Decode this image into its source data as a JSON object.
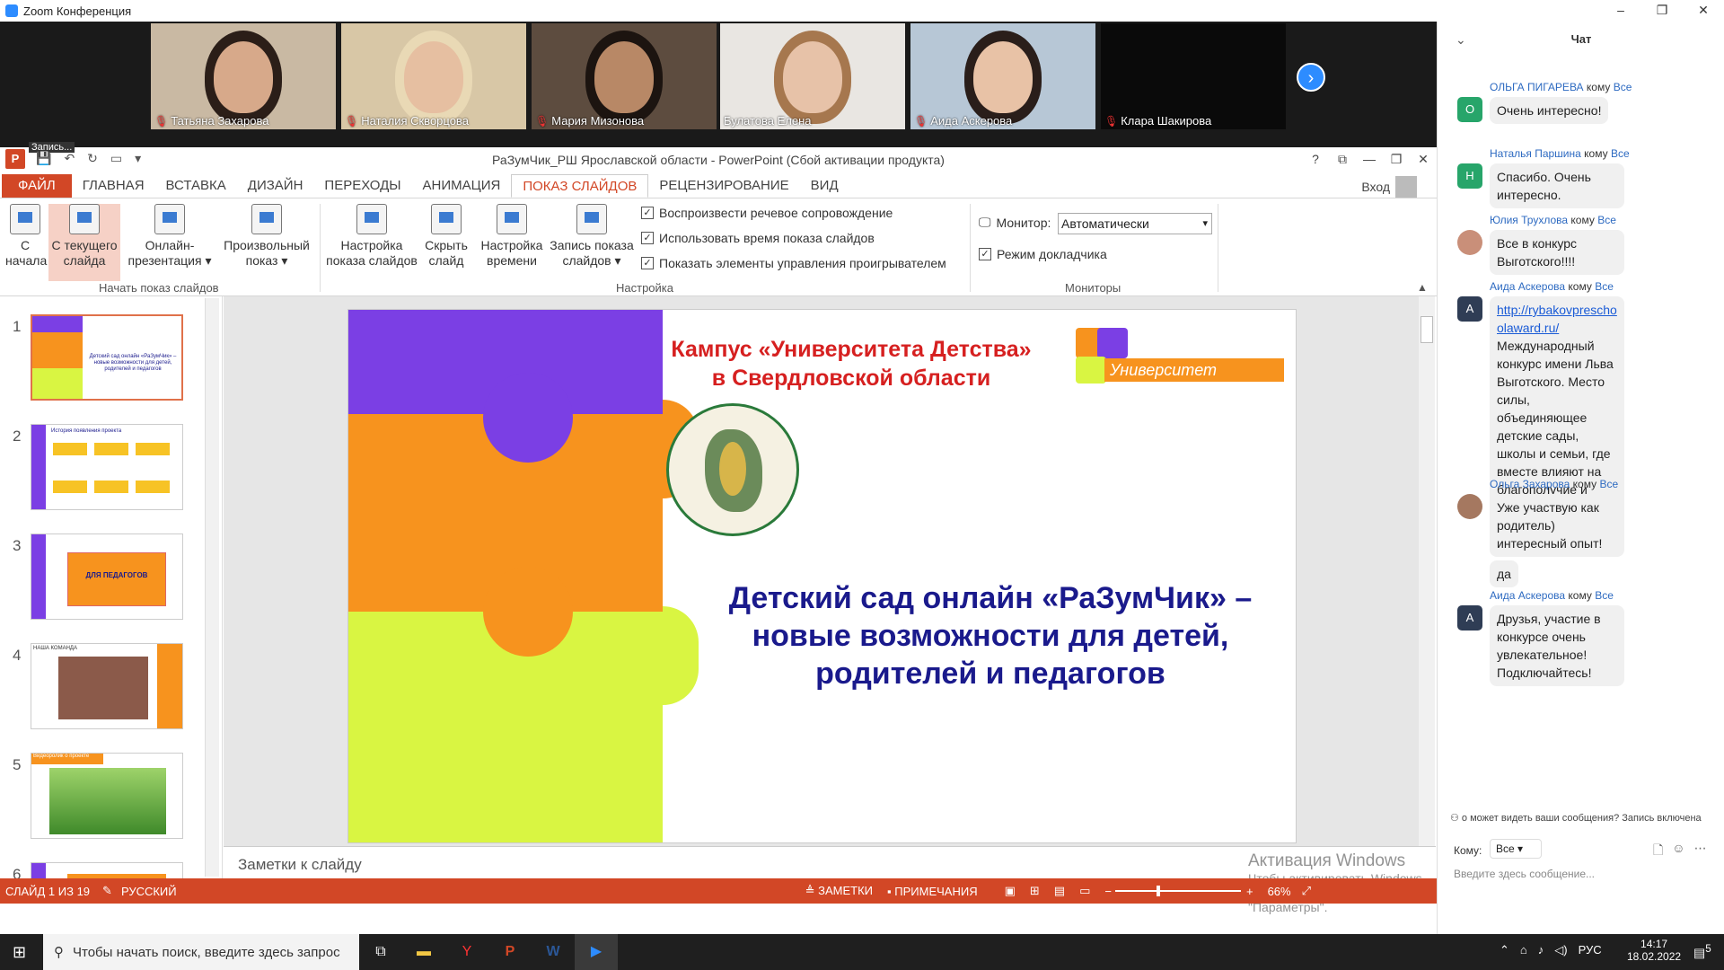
{
  "zoom": {
    "title": "Zoom Конференция",
    "win_min": "–",
    "win_max": "❐",
    "win_close": "✕"
  },
  "participants": [
    {
      "name": "Татьяна Захарова",
      "muted": true,
      "bg": "#c9b9a3",
      "face": "#d7a98a",
      "hair": "#2b1e18"
    },
    {
      "name": "Наталия Скворцова",
      "muted": true,
      "bg": "#d8c7a6",
      "face": "#e6bfa1",
      "hair": "#e9d9b5"
    },
    {
      "name": "Мария Мизонова",
      "muted": true,
      "bg": "#5d4c3f",
      "face": "#b88866",
      "hair": "#1c1410"
    },
    {
      "name": "Булатова Елена",
      "muted": false,
      "bg": "#e9e6e2",
      "face": "#e7c2a8",
      "hair": "#a6774e"
    },
    {
      "name": "Аида Аскерова",
      "muted": true,
      "bg": "#b7c7d6",
      "face": "#e8c2a6",
      "hair": "#2a1e1a"
    },
    {
      "name": "Клара Шакирова",
      "muted": true,
      "bg": "#0a0a0a",
      "face": "",
      "hair": ""
    }
  ],
  "ppt": {
    "title": "РаЗумЧик_РШ Ярославской области - PowerPoint (Сбой активации продукта)",
    "record_label": "Запись...",
    "help": "?",
    "restore": "⧉",
    "minimize": "—",
    "maximize": "❐",
    "close": "✕",
    "tabs": [
      "ФАЙЛ",
      "ГЛАВНАЯ",
      "ВСТАВКА",
      "ДИЗАЙН",
      "ПЕРЕХОДЫ",
      "АНИМАЦИЯ",
      "ПОКАЗ СЛАЙДОВ",
      "РЕЦЕНЗИРОВАНИЕ",
      "ВИД"
    ],
    "active_tab": "ПОКАЗ СЛАЙДОВ",
    "signin": "Вход",
    "ribbon": {
      "from_start": "С начала",
      "from_current": "С текущего слайда",
      "online": "Онлайн-презентация ▾",
      "custom": "Произвольный показ ▾",
      "group1": "Начать показ слайдов",
      "setup": "Настройка показа слайдов",
      "hide": "Скрыть слайд",
      "rehearse": "Настройка времени",
      "record": "Запись показа слайдов ▾",
      "chk1": "Воспроизвести речевое сопровождение",
      "chk2": "Использовать время показа слайдов",
      "chk3": "Показать элементы управления проигрывателем",
      "group2": "Настройка",
      "monitor_label": "Монитор:",
      "monitor_value": "Автоматически",
      "presenter": "Режим докладчика",
      "group3": "Мониторы"
    },
    "thumb_numbers": [
      "1",
      "2",
      "3",
      "4",
      "5",
      "6"
    ],
    "thumb_texts": {
      "t1": "Детский сад онлайн «РаЗумЧик» – новые возможности для детей, родителей и педагогов",
      "t2": "История появления проекта",
      "t3": "ДЛЯ ПЕДАГОГОВ",
      "t4": "НАША КОМАНДА",
      "t5": "Видеоролик о проекте"
    },
    "slide": {
      "campus_line1": "Кампус «Университета Детства»",
      "campus_line2": "в Свердловской области",
      "brand": "Университет Детства",
      "main_title": "Детский сад онлайн «РаЗумЧик» – новые возможности для детей, родителей и педагогов",
      "colors": {
        "purple": "#7b3fe4",
        "orange": "#f7931e",
        "lime": "#d9f542",
        "red": "#d62020",
        "navy": "#1a1a8c"
      }
    },
    "notes": "Заметки к слайду",
    "status": {
      "slide": "СЛАЙД 1 ИЗ 19",
      "lang": "РУССКИЙ",
      "notes_btn": "ЗАМЕТКИ",
      "comments_btn": "ПРИМЕЧАНИЯ",
      "zoom": "66%"
    },
    "activation": {
      "line1": "Активация Windows",
      "line2": "Чтобы активировать Windows, перейдите в раздел \"Параметры\"."
    }
  },
  "chat": {
    "title": "Чат",
    "messages": [
      {
        "from": "ОЛЬГА ПИГАРЕВА",
        "to": "Все",
        "initial": "О",
        "av": "#27a56a",
        "text": "Очень интересно!"
      },
      {
        "from": "Наталья Паршина",
        "to": "Все",
        "initial": "Н",
        "av": "#27a56a",
        "text": "Спасибо. Очень интересно."
      },
      {
        "from": "Юлия Трухлова",
        "to": "Все",
        "initial": "",
        "av": "#c98f79",
        "text": "Все в конкурс Выготского!!!!"
      },
      {
        "from": "Аида Аскерова",
        "to": "Все",
        "initial": "А",
        "av": "#2f3d55",
        "link": "http://rybakovpreschoolaward.ru/",
        "text": "Международный конкурс имени Льва Выготского. Место силы, объединяющее детские сады, школы и семьи, где вместе влияют на благополучие и качество жизни"
      },
      {
        "from": "Ольга Захарова",
        "to": "Все",
        "initial": "",
        "av": "#a57860",
        "text": "Уже участвую как родитель) интересный опыт!",
        "text2": "да"
      },
      {
        "from": "Аида Аскерова",
        "to": "Все",
        "initial": "А",
        "av": "#2f3d55",
        "text": "Друзья, участие в конкурсе очень увлекательное! Подключайтесь!"
      }
    ],
    "to_word": "кому",
    "notice": "о может видеть ваши сообщения? Запись включена",
    "to_label": "Кому:",
    "to_value": "Все",
    "placeholder": "Введите здесь сообщение..."
  },
  "taskbar": {
    "search": "Чтобы начать поиск, введите здесь запрос",
    "lang": "РУС",
    "time": "14:17",
    "date": "18.02.2022",
    "notif": "5"
  }
}
